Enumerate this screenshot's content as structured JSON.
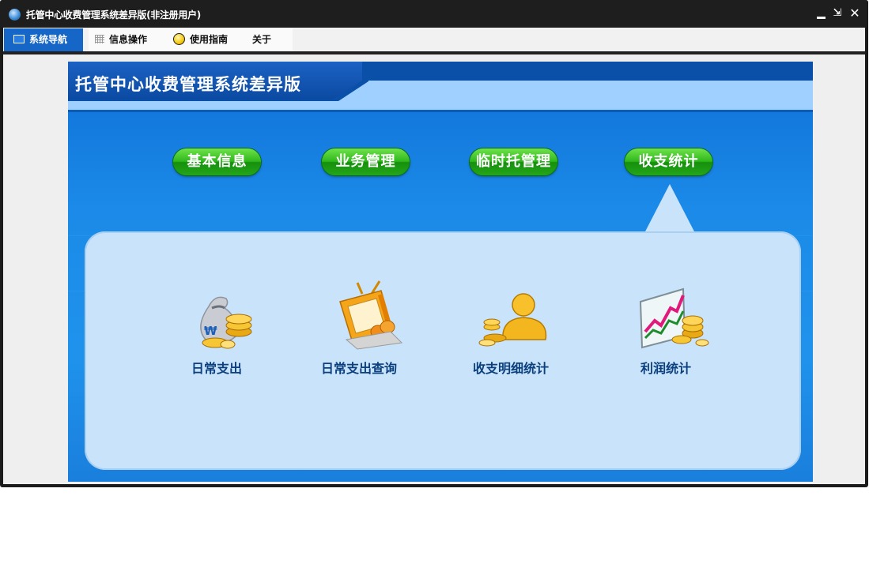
{
  "window": {
    "title": "托管中心收费管理系统差异版(非注册用户)",
    "controls": {
      "minimize": "",
      "restore": "⇲",
      "close": "✕"
    }
  },
  "menu": [
    {
      "label": "系统导航",
      "icon": "monitor-icon",
      "active": true
    },
    {
      "label": "信息操作",
      "icon": "grid-icon",
      "active": false
    },
    {
      "label": "使用指南",
      "icon": "help-icon",
      "active": false
    },
    {
      "label": "关于",
      "icon": "",
      "active": false
    }
  ],
  "banner": {
    "title": "托管中心收费管理系统差异版"
  },
  "nav_buttons": [
    "基本信息",
    "业务管理",
    "临时托管理",
    "收支统计"
  ],
  "functions": [
    {
      "label": "日常支出",
      "icon": "money-bag-coins-icon"
    },
    {
      "label": "日常支出查询",
      "icon": "tv-coins-icon"
    },
    {
      "label": "收支明细统计",
      "icon": "gold-person-coins-icon"
    },
    {
      "label": "利润统计",
      "icon": "chart-coins-icon"
    }
  ],
  "colors": {
    "accent": "#1666c7",
    "banner_blue": "#1b8ae8",
    "green_button": "#2fb81c",
    "panel": "#c9e3fb",
    "label_text": "#0b3f7e"
  }
}
